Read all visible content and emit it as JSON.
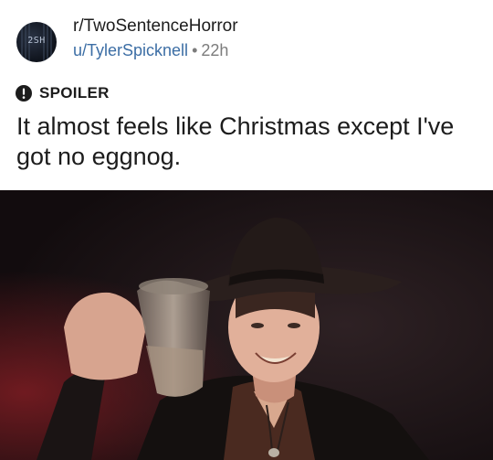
{
  "post": {
    "subreddit": "r/TwoSentenceHorror",
    "username": "u/TylerSpicknell",
    "separator": "•",
    "time_ago": "22h",
    "avatar_text": "2SH",
    "spoiler_label": "SPOILER",
    "title": "It almost feels like Christmas except I've got no eggnog."
  },
  "icons": {
    "spoiler": "exclamation-circle-icon"
  },
  "colors": {
    "text_primary": "#1c1c1c",
    "username_link": "#3c6ea5",
    "meta_gray": "#7c7c7c",
    "image_background": "#1a1214"
  }
}
